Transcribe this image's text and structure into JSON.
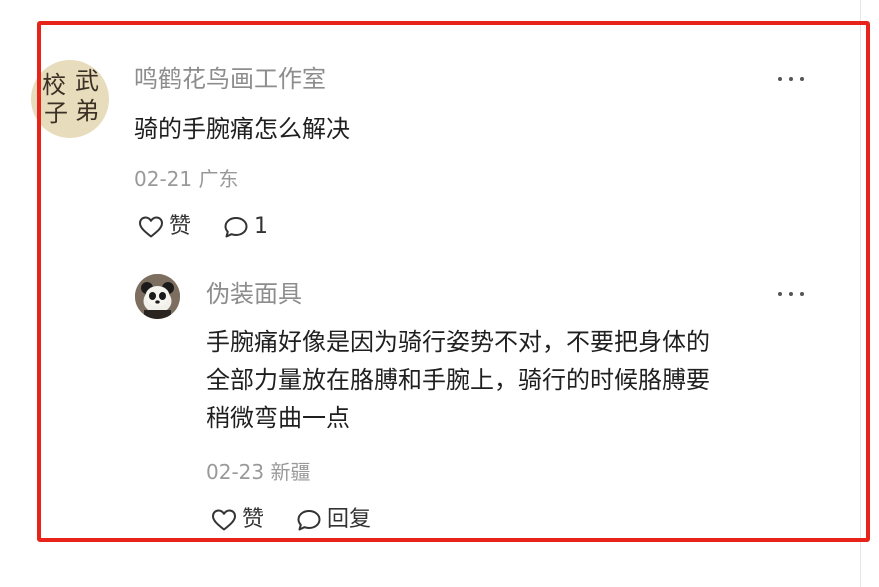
{
  "colors": {
    "highlight_border": "#e8231a",
    "username": "#8d8d8d",
    "meta": "#999999",
    "content": "#1f1f1f"
  },
  "comment": {
    "avatar_text": [
      "武",
      "校",
      "子",
      "弟"
    ],
    "username": "鸣鹤花鸟画工作室",
    "more_icon": "ellipsis-icon",
    "content": "骑的手腕痛怎么解决",
    "date": "02-21",
    "location": "广东",
    "like_icon": "heart-outline-icon",
    "like_label": "赞",
    "comment_icon": "speech-bubble-icon",
    "comment_count": "1"
  },
  "reply": {
    "avatar_icon": "panda-avatar-icon",
    "username": "伪装面具",
    "more_icon": "ellipsis-icon",
    "content_lines": [
      "手腕痛好像是因为骑行姿势不对，不要把身体的",
      "全部力量放在胳膊和手腕上，骑行的时候胳膊要",
      "稍微弯曲一点"
    ],
    "date": "02-23",
    "location": "新疆",
    "like_icon": "heart-outline-icon",
    "like_label": "赞",
    "reply_icon": "speech-bubble-icon",
    "reply_label": "回复"
  }
}
